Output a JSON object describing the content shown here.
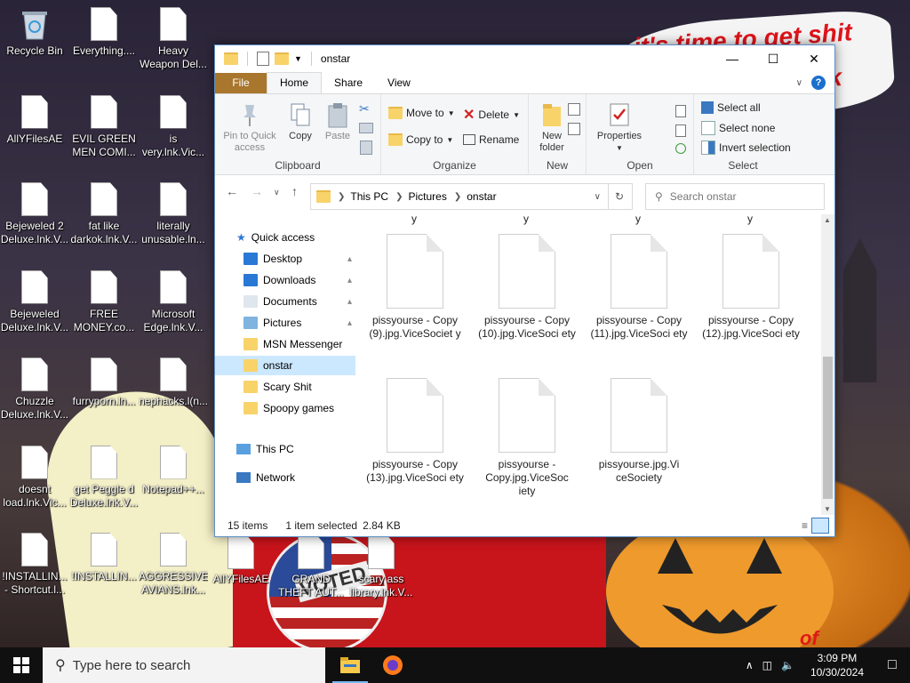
{
  "wallpaper": {
    "sign_text": "it's time to get shit",
    "sign_text_2": "ck",
    "sticker_text": "VOTED",
    "corner_text": "of"
  },
  "desktop_icons": [
    {
      "label": "Recycle Bin",
      "type": "recycle-bin"
    },
    {
      "label": "Everything....",
      "type": "file"
    },
    {
      "label": "Heavy Weapon Del...",
      "type": "file"
    },
    {
      "label": "AllYFilesAE",
      "type": "file"
    },
    {
      "label": "EVIL GREEN MEN COMI...",
      "type": "file"
    },
    {
      "label": "is very.lnk.Vic...",
      "type": "file"
    },
    {
      "label": "Bejeweled 2 Deluxe.lnk.V...",
      "type": "file"
    },
    {
      "label": "fat like darkok.lnk.V...",
      "type": "file"
    },
    {
      "label": "literally unusable.ln...",
      "type": "file"
    },
    {
      "label": "Bejeweled Deluxe.lnk.V...",
      "type": "file"
    },
    {
      "label": "FREE MONEY.co...",
      "type": "file"
    },
    {
      "label": "Microsoft Edge.lnk.V...",
      "type": "file"
    },
    {
      "label": "Chuzzle Deluxe.lnk.V...",
      "type": "file"
    },
    {
      "label": "furryporn.ln...",
      "type": "file"
    },
    {
      "label": "nephacks.l(n...",
      "type": "file"
    },
    {
      "label": "doesnt load.lnk.Vic...",
      "type": "file"
    },
    {
      "label": "get Peggle d Deluxe.lnk.V...",
      "type": "file"
    },
    {
      "label": "Notepad++...",
      "type": "file"
    },
    {
      "label": "!INSTALLIN... - Shortcut.l...",
      "type": "file"
    },
    {
      "label": "!INSTALLIN...",
      "type": "file"
    },
    {
      "label": "AGGRESSIVE AVIANS.lnk...",
      "type": "file"
    },
    {
      "label": "AllYFilesAE",
      "type": "file"
    },
    {
      "label": "GRAND THEFT AUT...",
      "type": "file"
    },
    {
      "label": "scary ass library.lnk.V...",
      "type": "file"
    }
  ],
  "window": {
    "title": "onstar",
    "tabs": [
      "File",
      "Home",
      "Share",
      "View"
    ],
    "ribbon": {
      "clipboard": {
        "name": "Clipboard",
        "pin": "Pin to Quick access",
        "copy": "Copy",
        "paste": "Paste"
      },
      "organize": {
        "name": "Organize",
        "move_to": "Move to",
        "copy_to": "Copy to",
        "delete": "Delete",
        "rename": "Rename"
      },
      "new": {
        "name": "New",
        "new_folder": "New folder"
      },
      "open": {
        "name": "Open",
        "properties": "Properties"
      },
      "select": {
        "name": "Select",
        "select_all": "Select all",
        "select_none": "Select none",
        "invert": "Invert selection"
      }
    },
    "address": {
      "crumbs": [
        "This PC",
        "Pictures",
        "onstar"
      ],
      "search_placeholder": "Search onstar"
    },
    "nav": {
      "quick_access": "Quick access",
      "items": [
        {
          "label": "Desktop",
          "pinned": true
        },
        {
          "label": "Downloads",
          "pinned": true
        },
        {
          "label": "Documents",
          "pinned": true
        },
        {
          "label": "Pictures",
          "pinned": true
        },
        {
          "label": "MSN Messenger",
          "pinned": false
        },
        {
          "label": "onstar",
          "pinned": false,
          "selected": true
        },
        {
          "label": "Scary Shit",
          "pinned": false
        },
        {
          "label": "Spoopy games",
          "pinned": false
        }
      ],
      "this_pc": "This PC",
      "network": "Network"
    },
    "cut_labels": [
      "y",
      "y",
      "y",
      "y"
    ],
    "files": [
      {
        "name": "pissyourse - Copy (9).jpg.ViceSociet y"
      },
      {
        "name": "pissyourse - Copy (10).jpg.ViceSoci ety"
      },
      {
        "name": "pissyourse - Copy (11).jpg.ViceSoci ety"
      },
      {
        "name": "pissyourse - Copy (12).jpg.ViceSoci ety"
      },
      {
        "name": "pissyourse - Copy (13).jpg.ViceSoci ety"
      },
      {
        "name": "pissyourse - Copy.jpg.ViceSoc iety"
      },
      {
        "name": "pissyourse.jpg.Vi ceSociety"
      }
    ],
    "status": {
      "items": "15 items",
      "selected": "1 item selected",
      "size": "2.84 KB"
    }
  },
  "taskbar": {
    "search_placeholder": "Type here to search",
    "time": "3:09 PM",
    "date": "10/30/2024"
  }
}
